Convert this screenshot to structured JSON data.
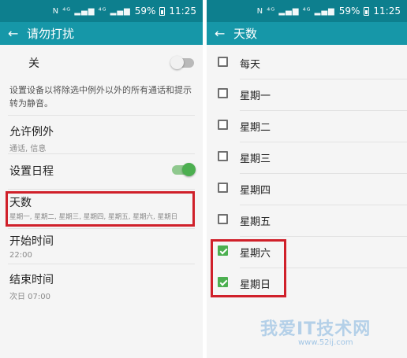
{
  "status": {
    "battery": "59%",
    "time": "11:25",
    "icons": "N ⁴ᴳ ▂▄▆ ⁴ᴳ ▂▄▆"
  },
  "left": {
    "title": "请勿打扰",
    "off_label": "关",
    "description": "设置设备以将除选中例外以外的所有通话和提示转为静音。",
    "exceptions": {
      "title": "允许例外",
      "sub": "通话, 信息"
    },
    "schedule": {
      "title": "设置日程",
      "enabled": true
    },
    "days": {
      "title": "天数",
      "sub": "星期一, 星期二, 星期三, 星期四, 星期五, 星期六, 星期日"
    },
    "start": {
      "title": "开始时间",
      "sub": "22:00"
    },
    "end": {
      "title": "结束时间",
      "sub": "次日 07:00"
    }
  },
  "right": {
    "title": "天数",
    "days": [
      {
        "label": "每天",
        "checked": false
      },
      {
        "label": "星期一",
        "checked": false
      },
      {
        "label": "星期二",
        "checked": false
      },
      {
        "label": "星期三",
        "checked": false
      },
      {
        "label": "星期四",
        "checked": false
      },
      {
        "label": "星期五",
        "checked": false
      },
      {
        "label": "星期六",
        "checked": true
      },
      {
        "label": "星期日",
        "checked": true
      }
    ]
  },
  "watermark": {
    "text": "我爱IT技术网",
    "url": "www.52ij.com"
  },
  "colors": {
    "statusbar": "#0d7f8e",
    "appbar": "#1697a8",
    "accent": "#4caf50",
    "highlight": "#d0202a"
  }
}
